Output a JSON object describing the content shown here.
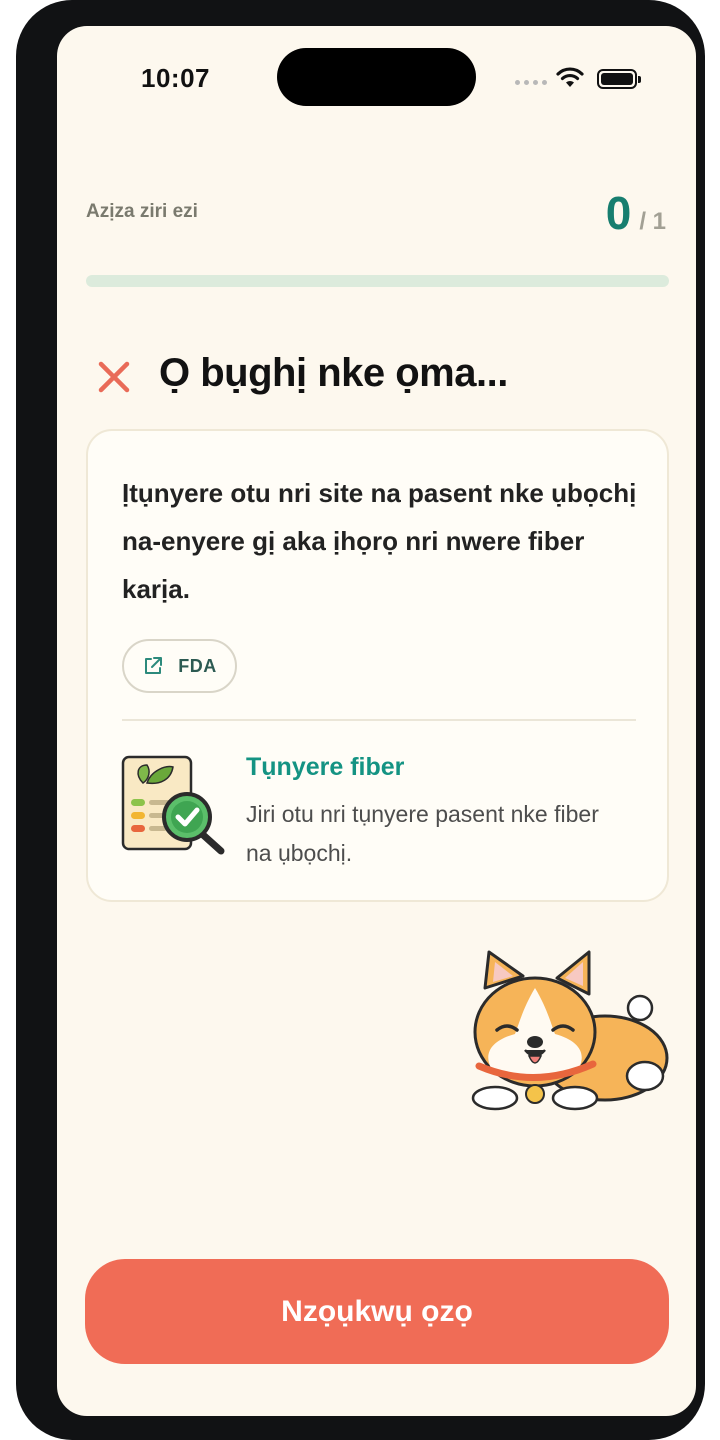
{
  "status_bar": {
    "time": "10:07"
  },
  "progress": {
    "label": "Azịza ziri ezi",
    "current": "0",
    "total": "/ 1",
    "fraction": 0
  },
  "result": {
    "title": "Ọ bụghị nke ọma...",
    "icon": "close-icon",
    "icon_color": "#e96b58"
  },
  "card": {
    "explanation": "Ịtụnyere otu nri site na pasent nke ụbọchị na-enyere gị aka ịhọrọ nri nwere fiber karịa.",
    "source": {
      "label": "FDA",
      "icon": "external-link-icon"
    },
    "tip": {
      "title": "Tụnyere fiber",
      "body": "Jiri otu nri tụnyere pasent nke fiber na ụbọchị.",
      "illustration": "nutrition-label-magnifier-icon"
    }
  },
  "mascot": {
    "icon": "sleeping-corgi-icon"
  },
  "actions": {
    "next_label": "Nzọụkwụ ọzọ"
  },
  "colors": {
    "background": "#fdf8ee",
    "accent_teal": "#177e6f",
    "button_coral": "#f06c56",
    "error_red": "#e96b58",
    "progress_track": "#dcebdc"
  }
}
